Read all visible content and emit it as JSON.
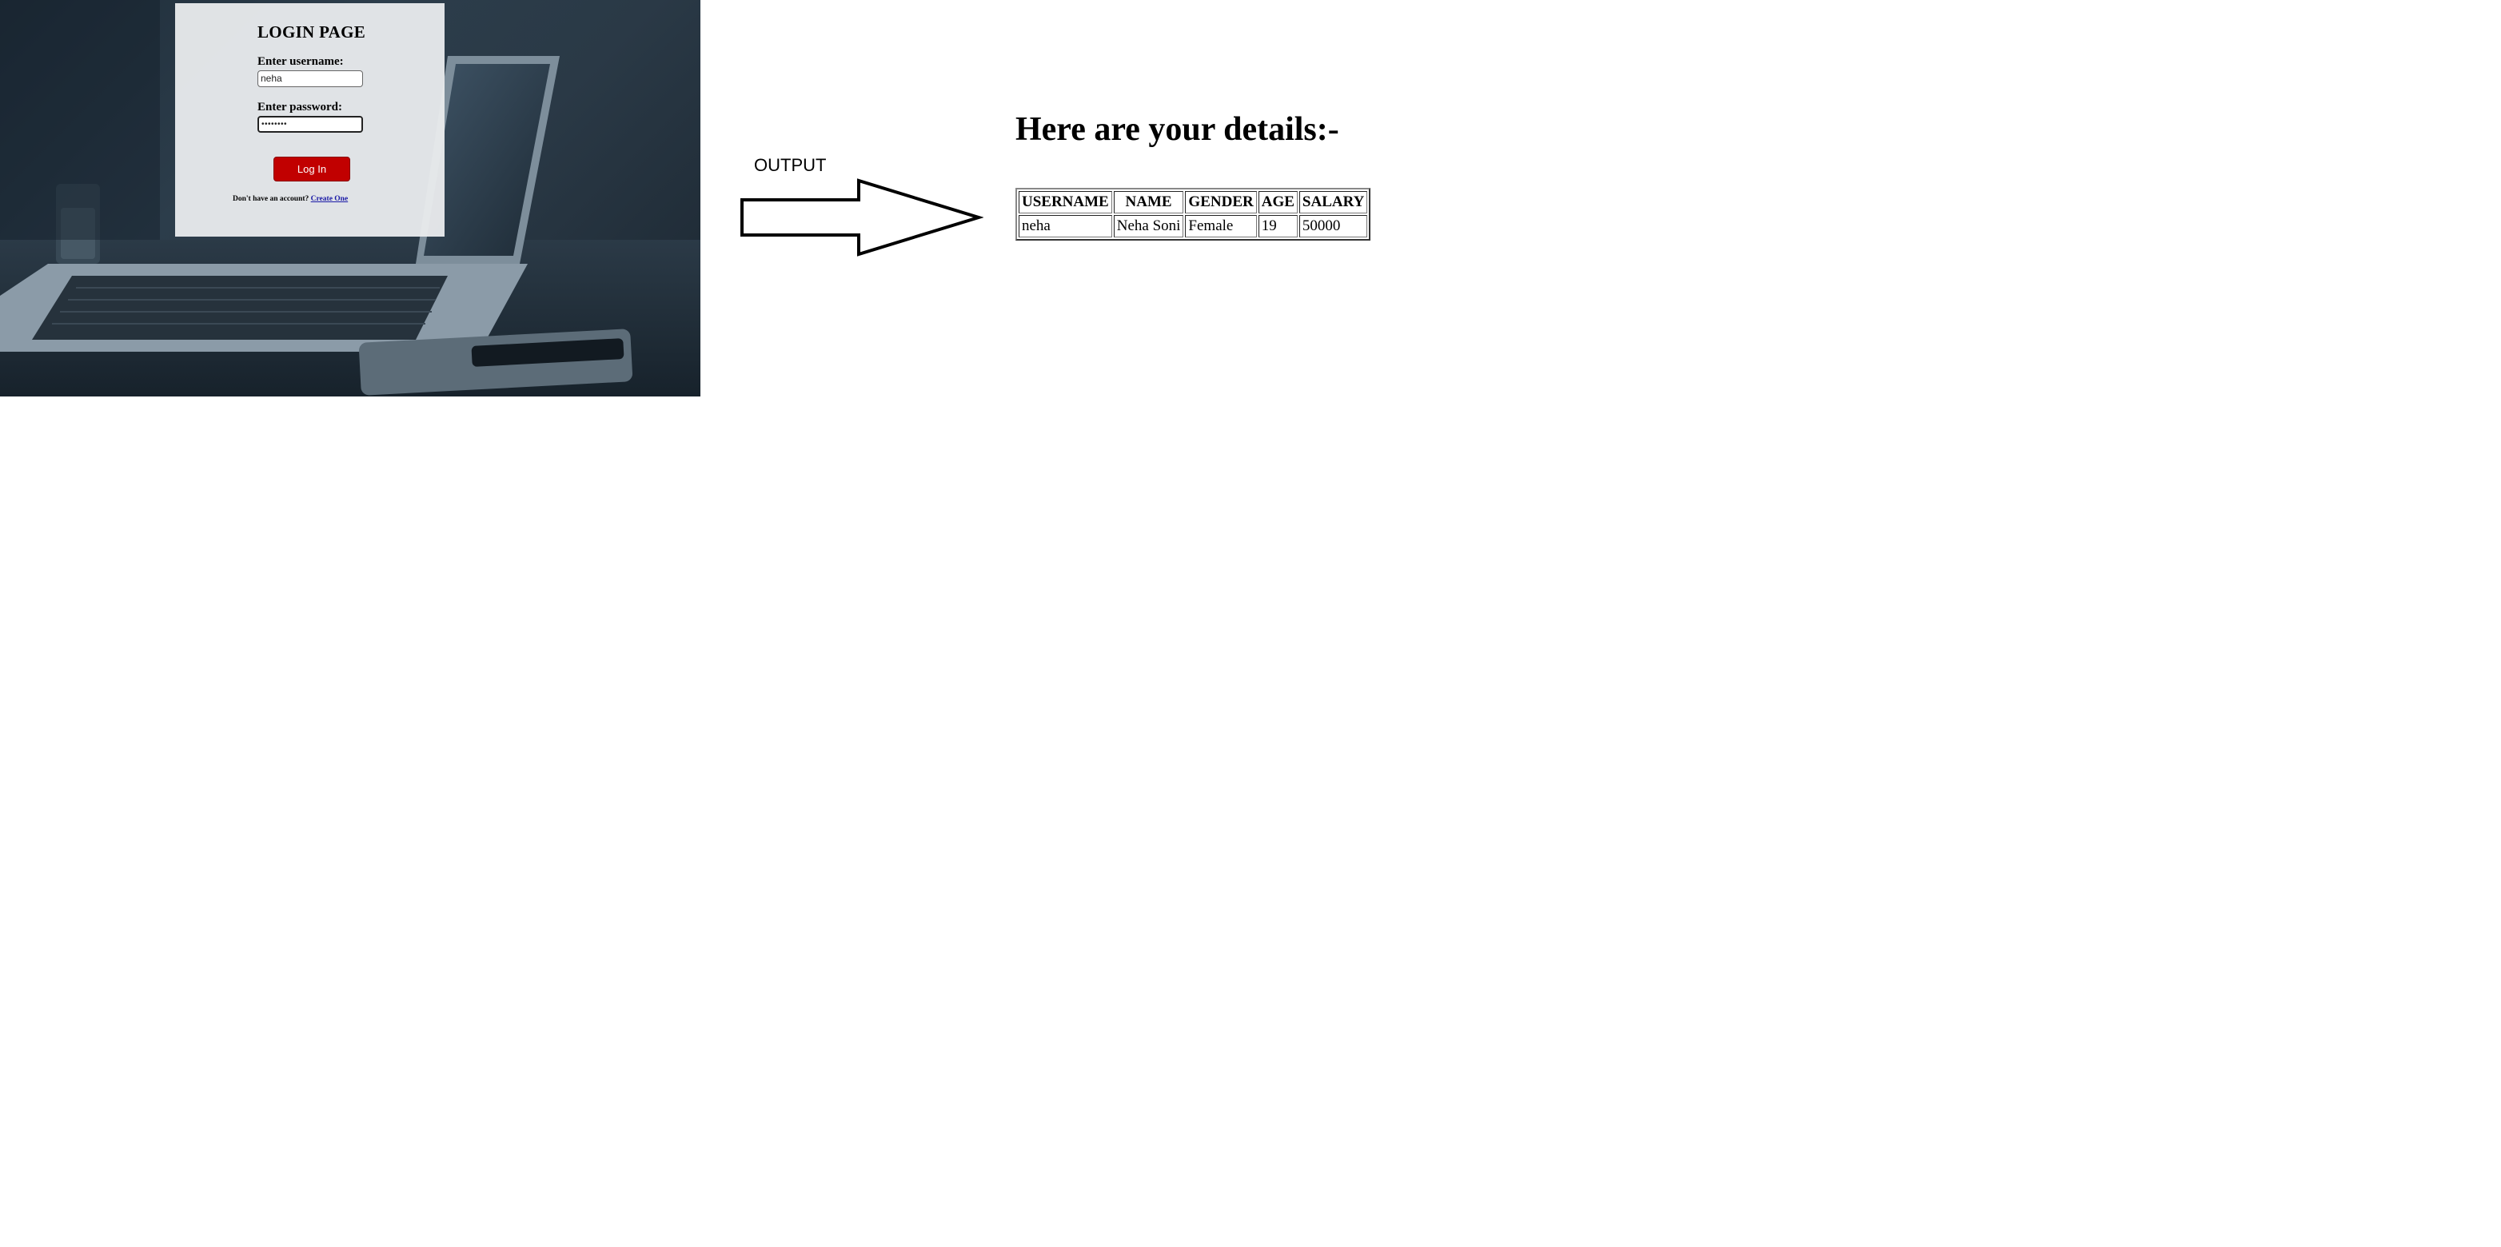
{
  "login_page": {
    "title": "LOGIN PAGE",
    "username_label": "Enter username:",
    "username_value": "neha",
    "password_label": "Enter password:",
    "password_value": "••••••••",
    "login_button": "Log In",
    "signup_prompt": "Don't have an account?",
    "signup_link": "Create One"
  },
  "output_label": "OUTPUT",
  "details": {
    "heading": "Here are your details:-",
    "columns": [
      "USERNAME",
      "NAME",
      "GENDER",
      "AGE",
      "SALARY"
    ],
    "rows": [
      [
        "neha",
        "Neha Soni",
        "Female",
        "19",
        "50000"
      ]
    ]
  }
}
